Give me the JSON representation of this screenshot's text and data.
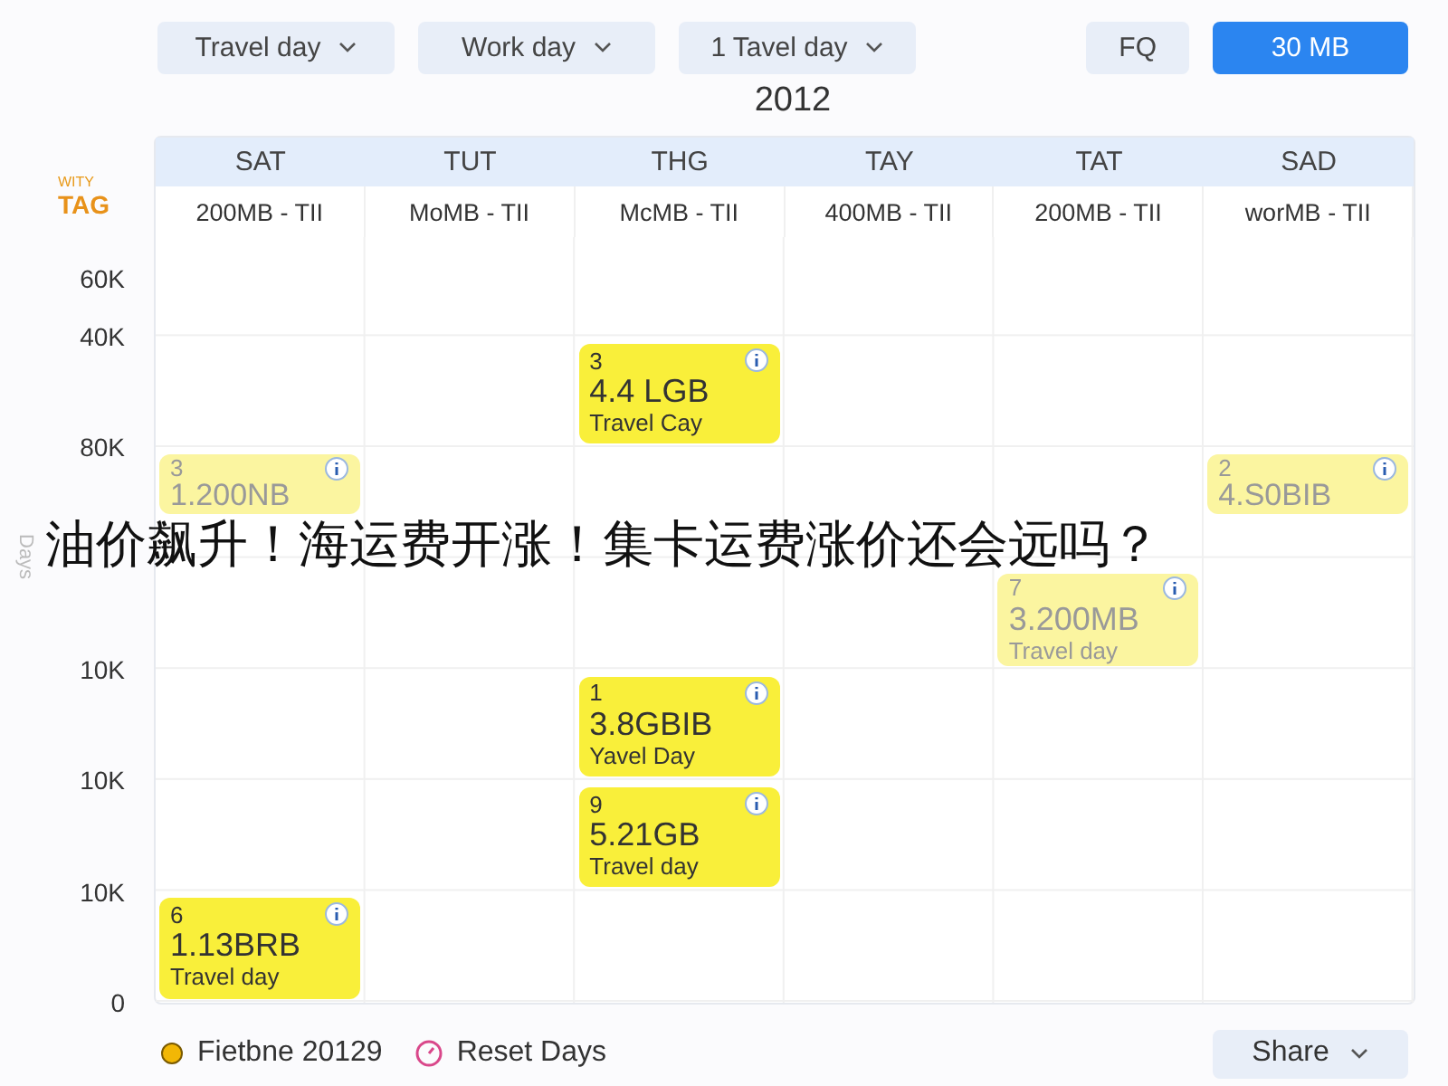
{
  "filters": [
    {
      "label": "Travel day"
    },
    {
      "label": "Work day"
    },
    {
      "label": "1 Tavel day"
    }
  ],
  "actions": [
    {
      "label": "FQ",
      "selected": false
    },
    {
      "label": "30 MB",
      "selected": true
    }
  ],
  "year": "2012",
  "tag": {
    "caption": "WITY",
    "label": "TAG"
  },
  "columns": [
    {
      "day": "SAT",
      "summary": "200MB - TII"
    },
    {
      "day": "TUT",
      "summary": "MoMB - TII"
    },
    {
      "day": "THG",
      "summary": "McMB - TII"
    },
    {
      "day": "TAY",
      "summary": "400MB - TII"
    },
    {
      "day": "TAT",
      "summary": "200MB - TII"
    },
    {
      "day": "SAD",
      "summary": "worMB - TII"
    }
  ],
  "y_axis": {
    "title": "Days",
    "labels": [
      "60K",
      "40K",
      "80K",
      "10K",
      "10K",
      "10K",
      "0"
    ]
  },
  "events": [
    {
      "number": "3",
      "value": "4.4 LGB",
      "label": "Travel Cay",
      "faded": false
    },
    {
      "number": "3",
      "value": "1.200NB",
      "faded": true
    },
    {
      "number": "2",
      "value": "4.S0BIB",
      "faded": true
    },
    {
      "number": "7",
      "value": "3.200MB",
      "label": "Travel day",
      "faded": true
    },
    {
      "number": "1",
      "value": "3.8GBIB",
      "label": "Yavel Day",
      "faded": false
    },
    {
      "number": "9",
      "value": "5.21GB",
      "label": "Travel day",
      "faded": false
    },
    {
      "number": "6",
      "value": "1.13BRB",
      "label": "Travel day",
      "faded": false
    }
  ],
  "headline": "油价飙升！海运费开涨！集卡运费涨价还会远吗？",
  "legend": [
    {
      "kind": "dot",
      "label": "Fietbne 20129",
      "color": "#f2b705"
    },
    {
      "kind": "clock",
      "label": "Reset Days",
      "color": "#d9478a"
    }
  ],
  "share": {
    "label": "Share"
  }
}
